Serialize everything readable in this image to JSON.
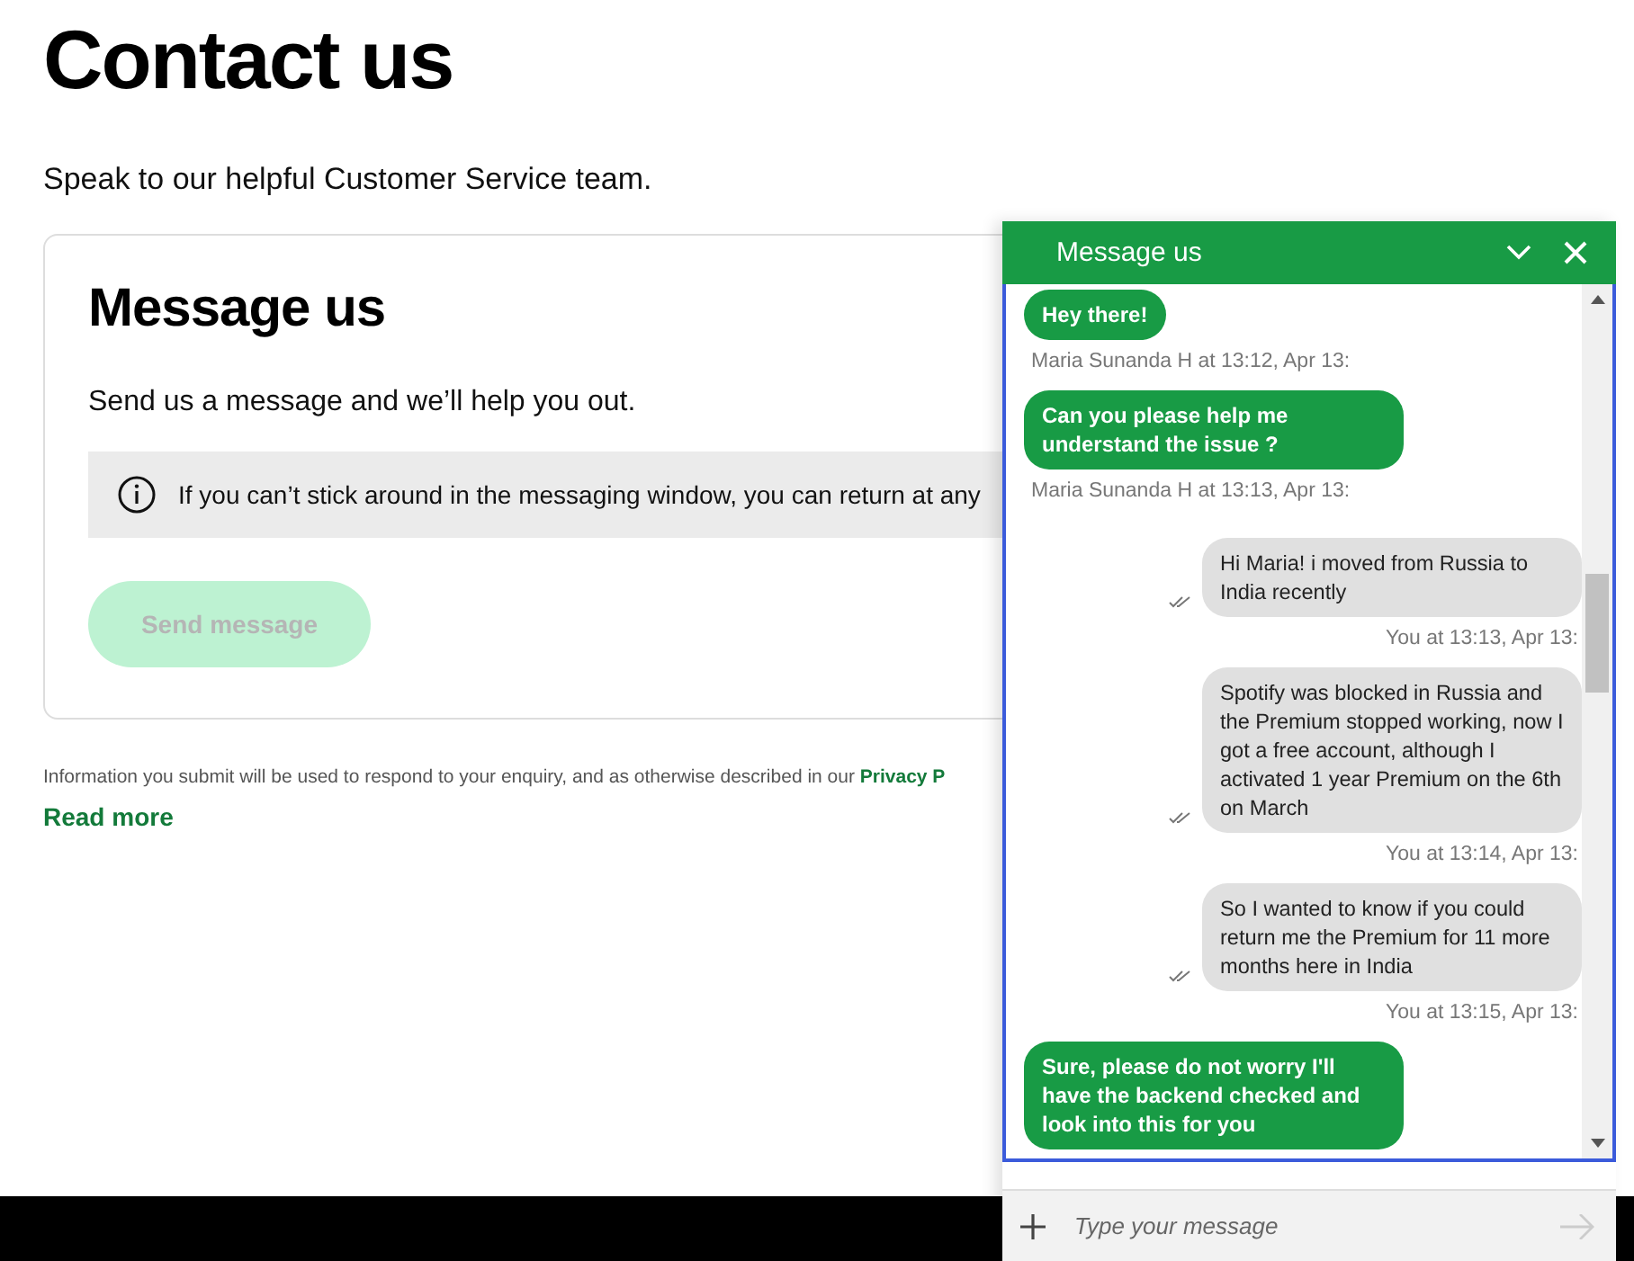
{
  "page": {
    "title": "Contact us",
    "subtitle": "Speak to our helpful Customer Service team."
  },
  "card": {
    "title": "Message us",
    "text": "Send us a message and we’ll help you out.",
    "info": "If you can’t stick around in the messaging window, you can return at any",
    "button": {
      "label": "Send message",
      "disabled": true
    }
  },
  "footnote": {
    "text": "Information you submit will be used to respond to your enquiry, and as otherwise described in our ",
    "link": "Privacy P",
    "read_more": "Read more"
  },
  "chat": {
    "title": "Message us",
    "messages": [
      {
        "kind": "agent",
        "text": "Hey there!",
        "meta": "Maria Sunanda H at 13:12, Apr 13:"
      },
      {
        "kind": "agent",
        "text": "Can you please help me understand the issue ?",
        "meta": "Maria Sunanda H at 13:13, Apr 13:"
      },
      {
        "kind": "user",
        "text": "Hi Maria! i moved from Russia to India recently",
        "meta": "You at 13:13, Apr 13:",
        "read": true
      },
      {
        "kind": "user",
        "text": "Spotify was blocked in Russia and the Premium stopped working, now I got a free account, although I activated 1 year Premium on the 6th on March",
        "meta": "You at 13:14, Apr 13:",
        "read": true
      },
      {
        "kind": "user",
        "text": "So I wanted to know if you could return me the Premium for 11 more months here in India",
        "meta": "You at 13:15, Apr 13:",
        "read": true
      },
      {
        "kind": "agent",
        "text": "Sure, please do not worry I'll have the backend checked and look into this for you"
      }
    ],
    "input": {
      "placeholder": "Type your message"
    }
  }
}
